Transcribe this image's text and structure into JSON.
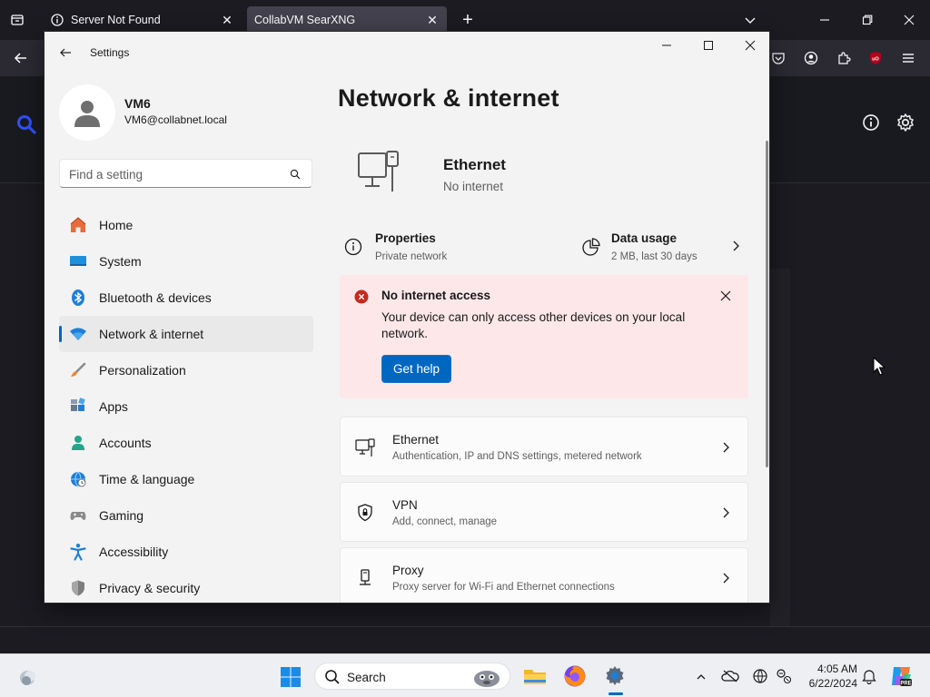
{
  "browser": {
    "tabs": [
      {
        "label": "Server Not Found",
        "icon": "info-icon"
      },
      {
        "label": "CollabVM SearXNG",
        "icon": "none"
      }
    ],
    "new_tab_symbol": "+",
    "window_controls": [
      "minimize",
      "restore",
      "close"
    ]
  },
  "settings": {
    "window_title": "Settings",
    "profile": {
      "name": "VM6",
      "email": "VM6@collabnet.local"
    },
    "search": {
      "placeholder": "Find a setting"
    },
    "nav": [
      {
        "label": "Home",
        "icon": "home-icon"
      },
      {
        "label": "System",
        "icon": "system-icon"
      },
      {
        "label": "Bluetooth & devices",
        "icon": "bluetooth-icon"
      },
      {
        "label": "Network & internet",
        "icon": "wifi-icon",
        "selected": true
      },
      {
        "label": "Personalization",
        "icon": "brush-icon"
      },
      {
        "label": "Apps",
        "icon": "apps-icon"
      },
      {
        "label": "Accounts",
        "icon": "accounts-icon"
      },
      {
        "label": "Time & language",
        "icon": "globe-clock-icon"
      },
      {
        "label": "Gaming",
        "icon": "gamepad-icon"
      },
      {
        "label": "Accessibility",
        "icon": "accessibility-icon"
      },
      {
        "label": "Privacy & security",
        "icon": "shield-icon"
      }
    ],
    "page_title": "Network & internet",
    "ethernet_header": {
      "title": "Ethernet",
      "status": "No internet"
    },
    "properties": {
      "title": "Properties",
      "subtitle": "Private network"
    },
    "data_usage": {
      "title": "Data usage",
      "subtitle": "2 MB, last 30 days"
    },
    "alert": {
      "title": "No internet access",
      "text": "Your device can only access other devices on your local network.",
      "button": "Get help"
    },
    "cards": [
      {
        "title": "Ethernet",
        "subtitle": "Authentication, IP and DNS settings, metered network",
        "icon": "ethernet-icon"
      },
      {
        "title": "VPN",
        "subtitle": "Add, connect, manage",
        "icon": "vpn-shield-icon"
      },
      {
        "title": "Proxy",
        "subtitle": "Proxy server for Wi-Fi and Ethernet connections",
        "icon": "proxy-icon"
      }
    ],
    "accent_color": "#0067c0",
    "alert_bg": "#fde7e9",
    "alert_icon_color": "#c42b1c"
  },
  "taskbar": {
    "search_label": "Search",
    "time": "4:05 AM",
    "date": "6/22/2024"
  }
}
